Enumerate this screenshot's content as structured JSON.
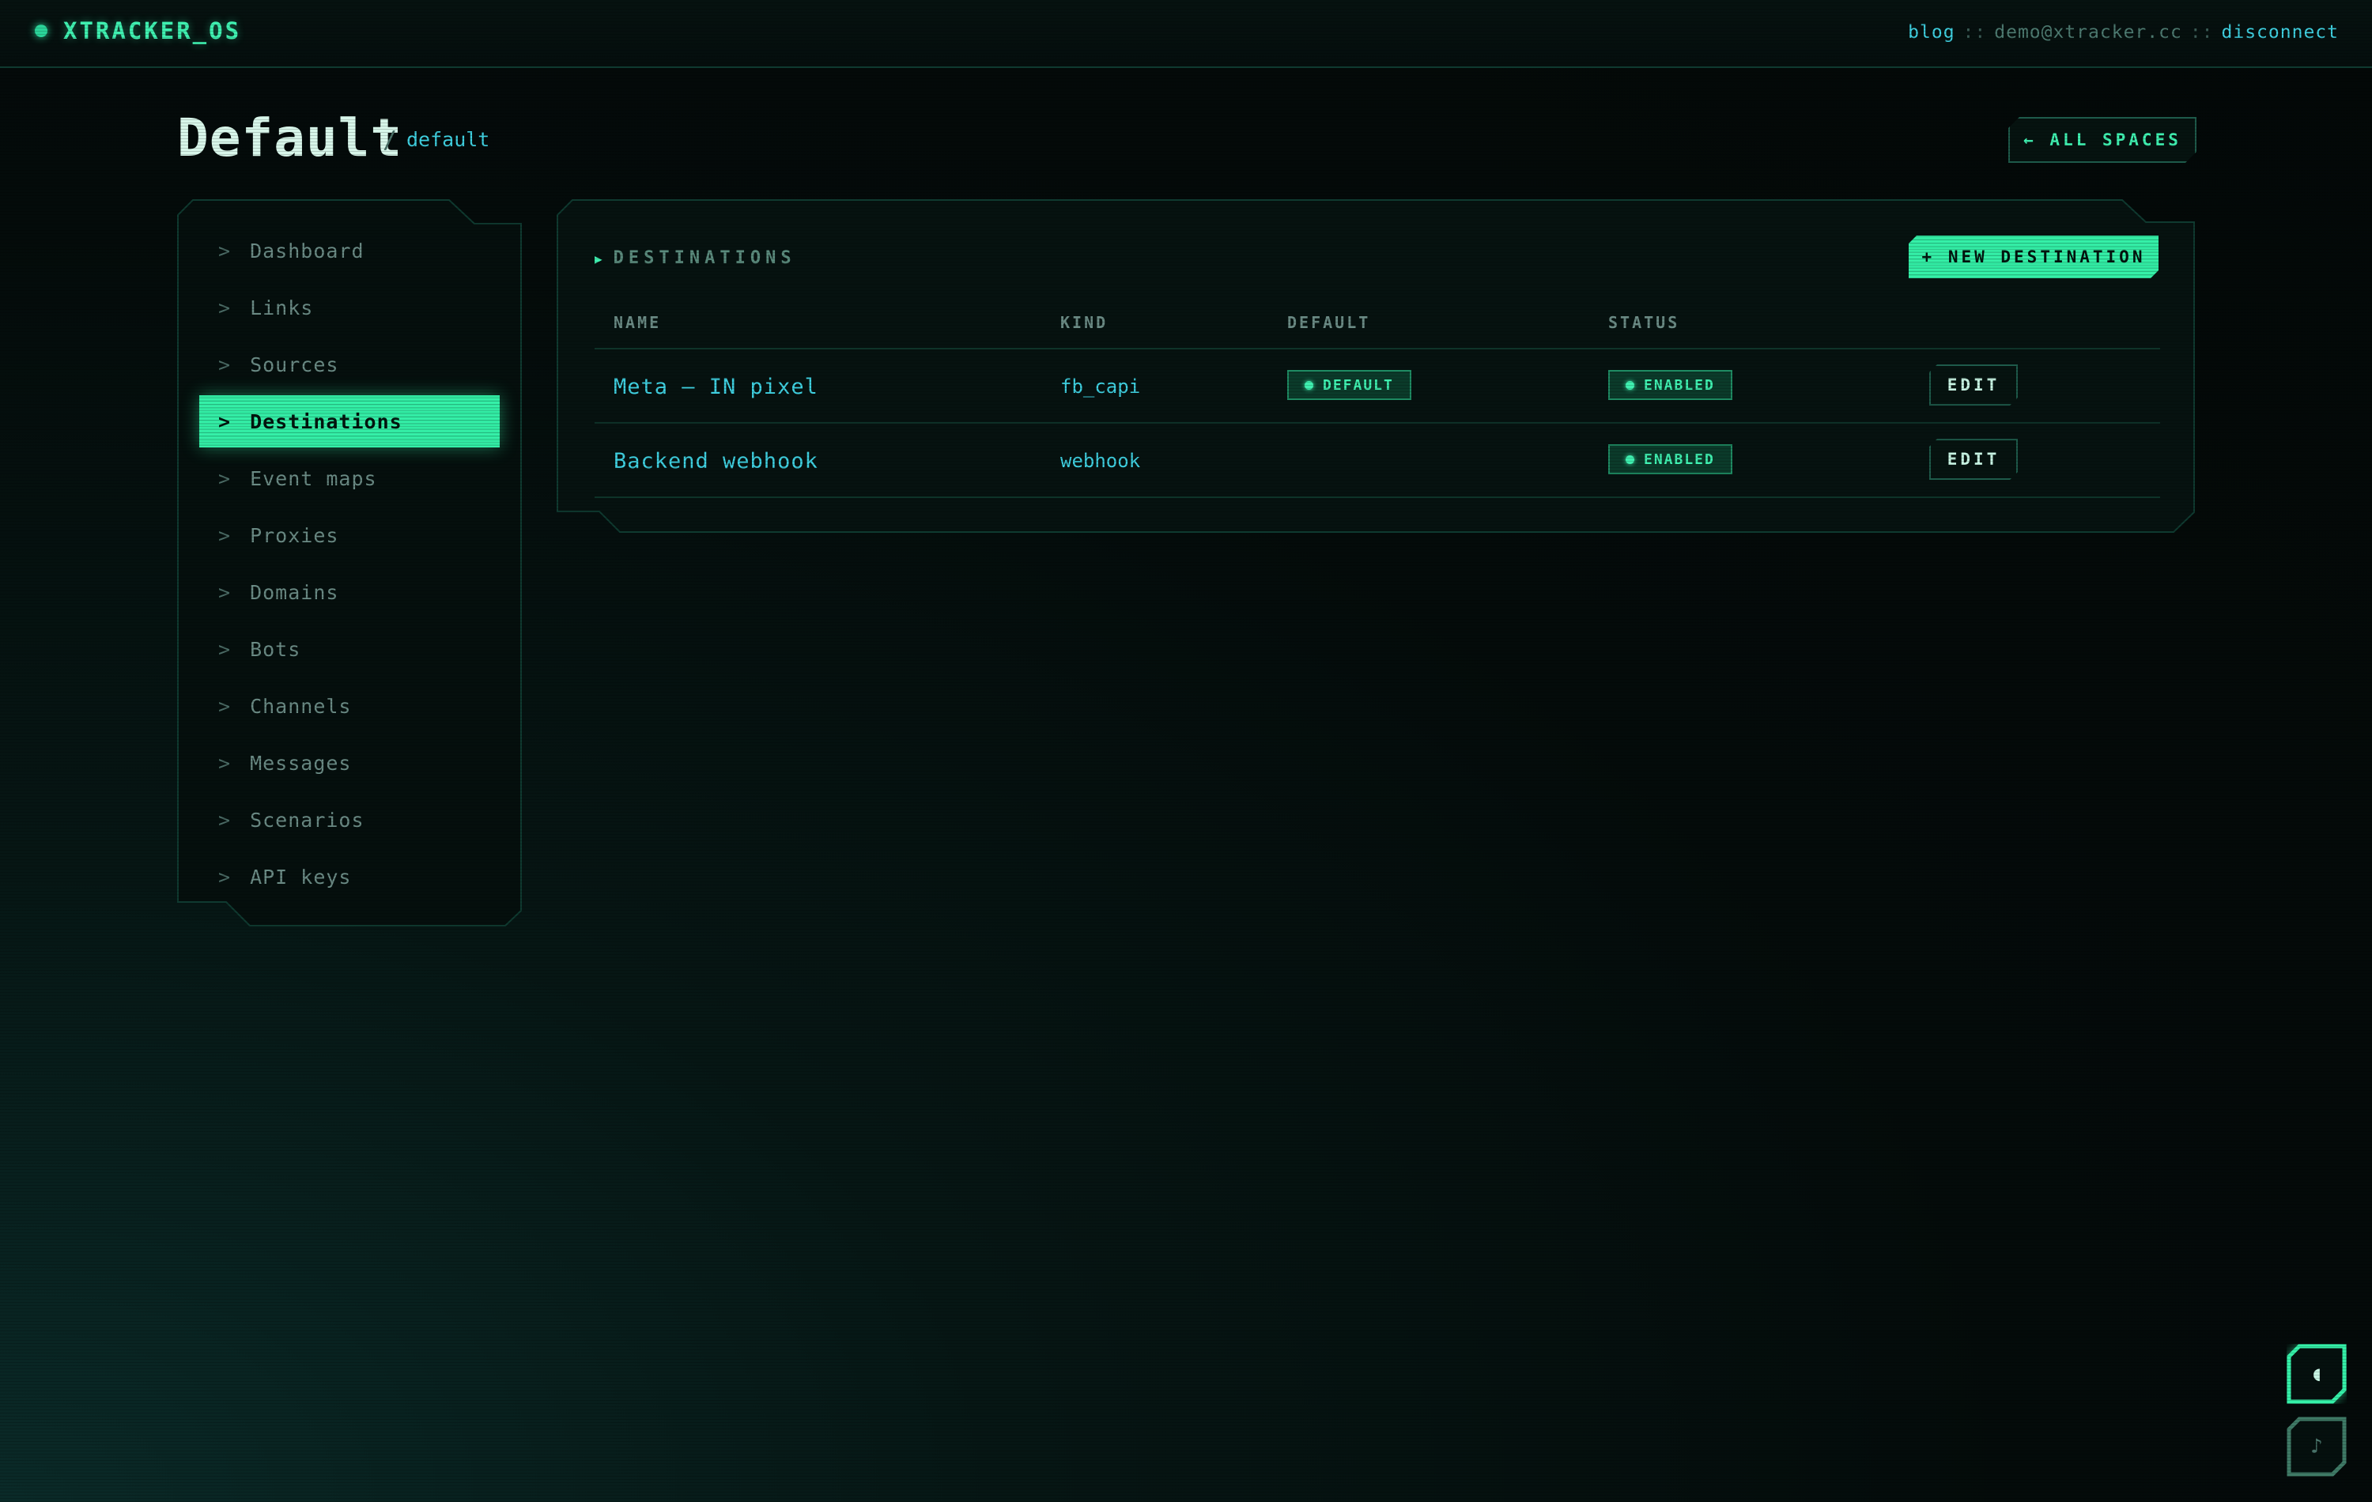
{
  "topbar": {
    "brand": "XTRACKER_OS",
    "blog_link": "blog",
    "separator": "::",
    "user_email": "demo@xtracker.cc",
    "disconnect_link": "disconnect"
  },
  "page": {
    "title": "Default",
    "slash": "/",
    "slug": "default",
    "back_button": "← ALL SPACES"
  },
  "sidebar": {
    "caret": ">",
    "items": [
      {
        "label": "Dashboard",
        "active": false
      },
      {
        "label": "Links",
        "active": false
      },
      {
        "label": "Sources",
        "active": false
      },
      {
        "label": "Destinations",
        "active": true
      },
      {
        "label": "Event maps",
        "active": false
      },
      {
        "label": "Proxies",
        "active": false
      },
      {
        "label": "Domains",
        "active": false
      },
      {
        "label": "Bots",
        "active": false
      },
      {
        "label": "Channels",
        "active": false
      },
      {
        "label": "Messages",
        "active": false
      },
      {
        "label": "Scenarios",
        "active": false
      },
      {
        "label": "API keys",
        "active": false
      }
    ]
  },
  "panel": {
    "title_marker": "▶",
    "title": "DESTINATIONS",
    "new_button": "+ NEW DESTINATION",
    "columns": [
      "NAME",
      "KIND",
      "DEFAULT",
      "STATUS"
    ],
    "rows": [
      {
        "name": "Meta — IN pixel",
        "kind": "fb_capi",
        "default_badge": "DEFAULT",
        "status": "ENABLED",
        "action": "EDIT"
      },
      {
        "name": "Backend webhook",
        "kind": "webhook",
        "default_badge": "",
        "status": "ENABLED",
        "action": "EDIT"
      }
    ]
  },
  "floating": {
    "theme_icon": "◖",
    "sound_icon": "♪"
  },
  "colors": {
    "accent": "#35f0a8",
    "link": "#3fd0e0",
    "background": "#040b0a",
    "border": "#0f3a30"
  }
}
